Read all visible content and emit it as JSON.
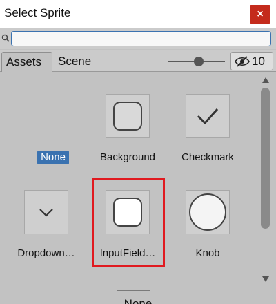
{
  "window": {
    "title": "Select Sprite",
    "close_glyph": "×",
    "close_color": "#c42b1c"
  },
  "search": {
    "value": "",
    "placeholder": ""
  },
  "tabs": [
    {
      "label": "Assets",
      "selected": true
    },
    {
      "label": "Scene",
      "selected": false
    }
  ],
  "toolbar": {
    "hidden_count": "10",
    "size_slider_fraction": 0.55
  },
  "sprites": [
    {
      "label": "None",
      "selected": true,
      "icon": "none"
    },
    {
      "label": "Background",
      "icon": "rounded-square-icon"
    },
    {
      "label": "Checkmark",
      "icon": "checkmark-icon"
    },
    {
      "label": "Dropdown…",
      "icon": "chevron-down-icon"
    },
    {
      "label": "InputField…",
      "icon": "rounded-square-white-icon",
      "highlighted": true
    },
    {
      "label": "Knob",
      "icon": "circle-icon"
    }
  ],
  "status": {
    "selected_name": "None"
  },
  "colors": {
    "accent": "#3a72b0",
    "highlight": "#e0191f",
    "background": "#c2c2c2"
  }
}
